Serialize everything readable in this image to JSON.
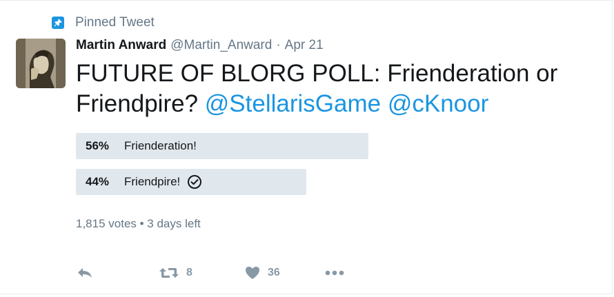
{
  "pinned": {
    "label": "Pinned Tweet"
  },
  "author": {
    "name": "Martin Anward",
    "handle": "@Martin_Anward",
    "separator": "·",
    "date": "Apr 21"
  },
  "tweet": {
    "text": "FUTURE OF BLORG POLL: Frienderation or Friendpire?",
    "mention1": "@StellarisGame",
    "mention2": "@cKnoor"
  },
  "poll": {
    "options": [
      {
        "percent_label": "56%",
        "percent": 56,
        "label": "Frienderation!"
      },
      {
        "percent_label": "44%",
        "percent": 44,
        "label": "Friendpire!",
        "selected": true
      }
    ],
    "summary": "1,815 votes • 3 days left"
  },
  "actions": {
    "retweets": "8",
    "likes": "36"
  },
  "colors": {
    "accent": "#1b95e0",
    "muted": "#657786",
    "bar": "#e1e8ed",
    "icon": "#8899a6"
  },
  "icons": [
    "pin-icon",
    "reply-icon",
    "retweet-icon",
    "heart-icon",
    "more-icon",
    "check-circle-icon"
  ]
}
